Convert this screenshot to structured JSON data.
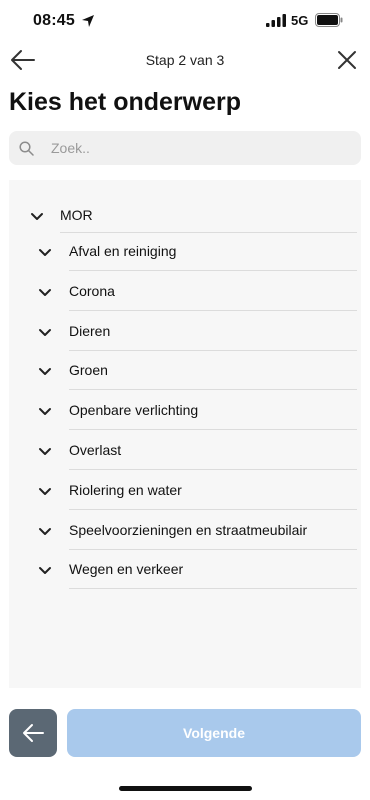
{
  "status_bar": {
    "time": "08:45",
    "network": "5G"
  },
  "header": {
    "step_label": "Stap 2 van 3"
  },
  "page": {
    "title": "Kies het onderwerp"
  },
  "search": {
    "placeholder": "Zoek..",
    "value": ""
  },
  "tree": {
    "root": {
      "label": "MOR"
    },
    "children": [
      {
        "label": "Afval en reiniging"
      },
      {
        "label": "Corona"
      },
      {
        "label": "Dieren"
      },
      {
        "label": "Groen"
      },
      {
        "label": "Openbare verlichting"
      },
      {
        "label": "Overlast"
      },
      {
        "label": "Riolering en water"
      },
      {
        "label": "Speelvoorzieningen en straatmeubilair"
      },
      {
        "label": "Wegen en verkeer"
      }
    ]
  },
  "footer": {
    "next_label": "Volgende"
  },
  "colors": {
    "next_button": "#a9c9ec",
    "back_button": "#5b6874",
    "panel": "#f7f7f7",
    "search_bg": "#f0f0f0"
  },
  "icons": [
    "location-arrow-icon",
    "signal-icon",
    "battery-icon",
    "back-arrow-icon",
    "close-icon",
    "search-icon",
    "chevron-down-icon"
  ]
}
